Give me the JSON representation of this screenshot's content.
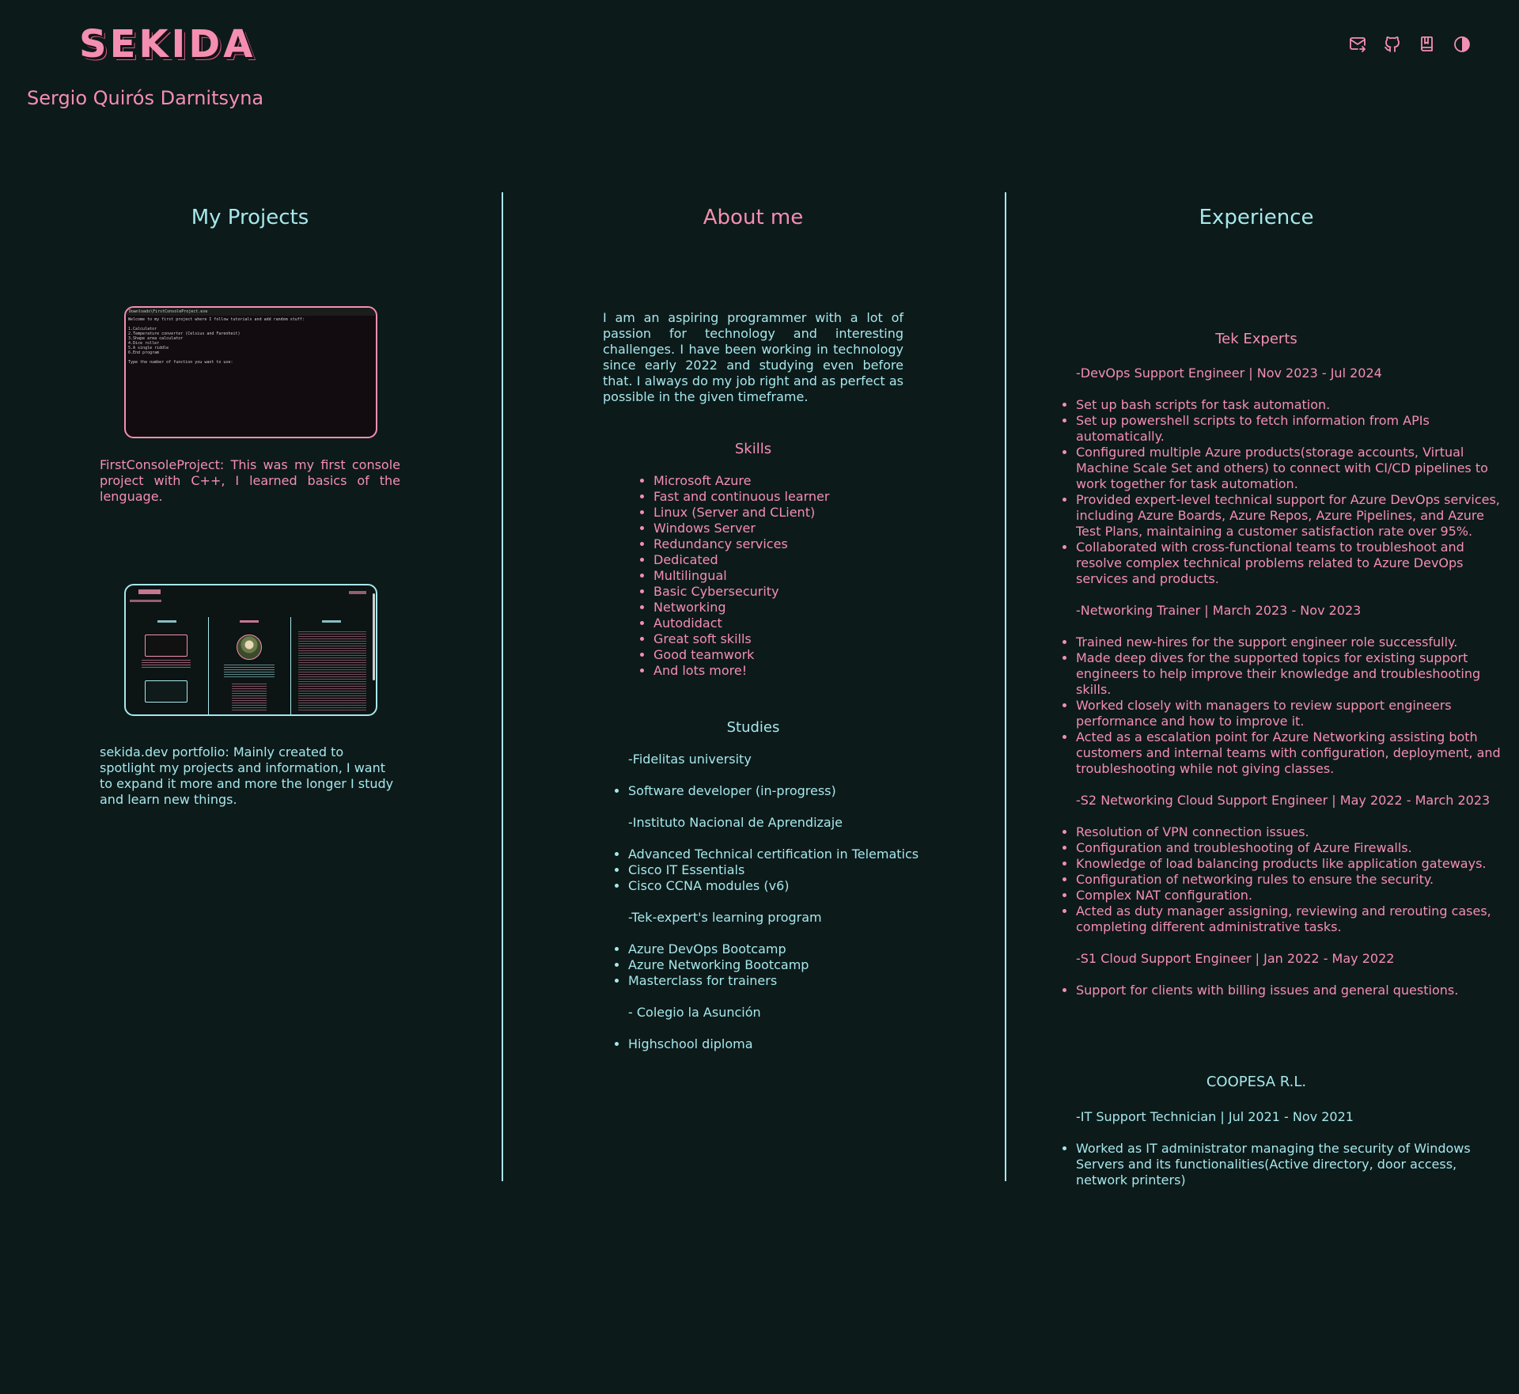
{
  "header": {
    "logo": "SEKIDA",
    "author": "Sergio Quirós Darnitsyna",
    "icons": [
      "mail-forward-icon",
      "github-icon",
      "book-icon",
      "contrast-toggle-icon"
    ]
  },
  "columns": {
    "projects_title": "My Projects",
    "about_title": "About me",
    "experience_title": "Experience"
  },
  "projects": [
    {
      "name": "FirstConsoleProject:",
      "description": "This was my first console project with C++, I learned basics of the lenguage.",
      "thumb": {
        "window_title": "Downloads\\FirstConsoleProject.exe",
        "lines": [
          "Welcome to my first project where I follow tutorials and add random stuff:",
          "",
          "1.Calculator",
          "2.Temperature converter (Celsius and Farenheit)",
          "3.Shape area calculator",
          "4.Dice roller",
          "5.A single riddle",
          "6.End program",
          "",
          "Type the number of function you want to use:"
        ]
      }
    },
    {
      "name": "sekida.dev portfolio:",
      "description": "Mainly created to spotlight my projects and information, I want to expand it more and more the longer I study and learn new things."
    }
  ],
  "about": {
    "text": "I am an aspiring programmer with a lot of passion for technology and interesting challenges. I have been working in technology since early 2022 and studying even before that. I always do my job right and as perfect as possible in the given timeframe.",
    "skills_title": "Skills",
    "skills": [
      "Microsoft Azure",
      "Fast and continuous learner",
      "Linux (Server and CLient)",
      "Windows Server",
      "Redundancy services",
      "Dedicated",
      "Multilingual",
      "Basic Cybersecurity",
      "Networking",
      "Autodidact",
      "Great soft skills",
      "Good teamwork",
      "And lots more!"
    ],
    "studies_title": "Studies",
    "studies": [
      {
        "head": "-Fidelitas university",
        "items": [
          "Software developer (in-progress)"
        ]
      },
      {
        "head": "-Instituto Nacional de Aprendizaje",
        "items": [
          "Advanced Technical certification in Telematics",
          "Cisco IT Essentials",
          "Cisco CCNA modules (v6)"
        ]
      },
      {
        "head": "-Tek-expert's learning program",
        "items": [
          "Azure DevOps Bootcamp",
          "Azure Networking Bootcamp",
          "Masterclass for trainers"
        ]
      },
      {
        "head": "- Colegio la Asunción",
        "items": [
          "Highschool diploma"
        ]
      }
    ]
  },
  "experience": {
    "companies": [
      {
        "name": "Tek Experts",
        "roles": [
          {
            "title": "-DevOps Support Engineer  |  Nov 2023 - Jul 2024",
            "items": [
              "Set up bash scripts for task automation.",
              "Set up powershell scripts to fetch information from APIs automatically.",
              "Configured multiple Azure products(storage accounts, Virtual Machine Scale Set and others) to connect with CI/CD pipelines to work together for task automation.",
              "Provided expert-level technical support for Azure DevOps services, including Azure Boards, Azure Repos, Azure Pipelines, and Azure Test Plans, maintaining a customer satisfaction rate over 95%.",
              "Collaborated with cross-functional teams to troubleshoot and resolve complex technical problems related to Azure DevOps services and products."
            ]
          },
          {
            "title": "-Networking Trainer  |  March 2023 - Nov 2023",
            "items": [
              "Trained new-hires for the support engineer role successfully.",
              "Made deep dives for the supported topics for existing support engineers to help improve their knowledge and troubleshooting skills.",
              "Worked closely with managers to review support engineers performance and how to improve it.",
              "Acted as a escalation point for Azure Networking assisting both customers and internal teams with configuration, deployment, and troubleshooting while not giving classes."
            ]
          },
          {
            "title": "-S2 Networking Cloud Support Engineer  |  May 2022 - March 2023",
            "items": [
              "Resolution of VPN connection issues.",
              "Configuration and troubleshooting of Azure Firewalls.",
              "Knowledge of load balancing products like application gateways.",
              "Configuration of networking rules to ensure the security.",
              "Complex NAT configuration.",
              "Acted as duty manager assigning, reviewing and rerouting cases, completing different administrative tasks."
            ]
          },
          {
            "title": "-S1 Cloud Support Engineer  |  Jan 2022 - May 2022",
            "items": [
              "Support for clients with billing issues and general questions."
            ]
          }
        ]
      },
      {
        "name": "COOPESA R.L.",
        "roles": [
          {
            "title": "-IT Support Technician  |  Jul 2021 - Nov 2021",
            "items": [
              "Worked as IT administrator managing the security of Windows Servers and its functionalities(Active directory, door access, network printers)"
            ]
          }
        ]
      }
    ]
  },
  "colors": {
    "background": "#0d1a1a",
    "pink": "#f48fb1",
    "cyan": "#a6e8ec"
  }
}
